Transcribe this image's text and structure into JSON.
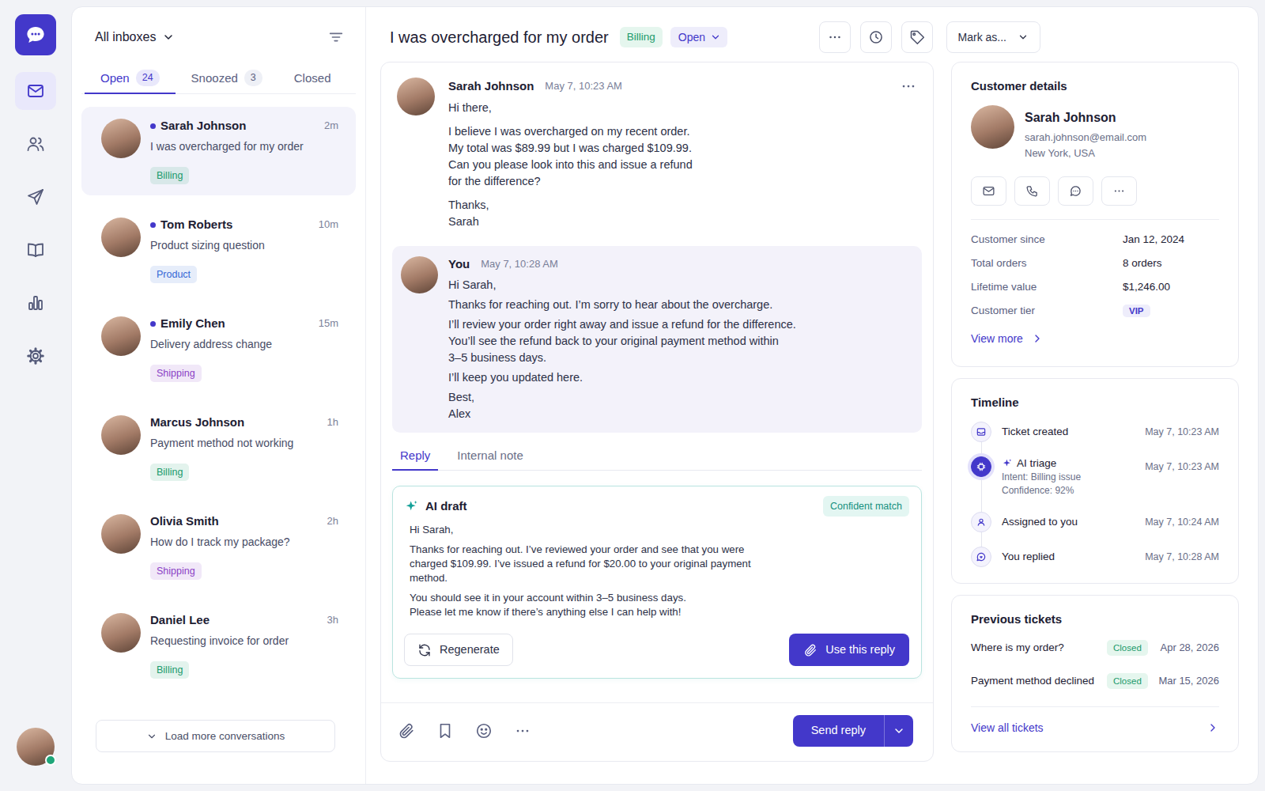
{
  "user": {
    "online": true
  },
  "rail": {
    "items": [
      {
        "selected": true
      },
      {
        "selected": false
      },
      {
        "selected": false
      },
      {
        "selected": false
      },
      {
        "selected": false
      },
      {
        "selected": false
      }
    ]
  },
  "inbox": {
    "label": "All inboxes"
  },
  "list_tabs": [
    {
      "label": "Open",
      "count": "24",
      "selected": true
    },
    {
      "label": "Snoozed",
      "count": "3",
      "selected": false
    },
    {
      "label": "Closed",
      "selected": false
    }
  ],
  "conversations": [
    {
      "name": "Sarah Johnson",
      "time": "2m",
      "subject": "I was overcharged for my order",
      "tag": {
        "label": "Billing",
        "color": "#1a9a6b"
      },
      "unread": true,
      "selected": true
    },
    {
      "name": "Tom Roberts",
      "time": "10m",
      "subject": "Product sizing question",
      "tag": {
        "label": "Product",
        "color": "#3467d6"
      },
      "unread": true,
      "selected": false
    },
    {
      "name": "Emily Chen",
      "time": "15m",
      "subject": "Delivery address change",
      "tag": {
        "label": "Shipping",
        "color": "#8b3fc6"
      },
      "unread": true,
      "selected": false
    },
    {
      "name": "Marcus Johnson",
      "time": "1h",
      "subject": "Payment method not working",
      "tag": {
        "label": "Billing",
        "color": "#1a9a6b"
      },
      "unread": false,
      "selected": false
    },
    {
      "name": "Olivia Smith",
      "time": "2h",
      "subject": "How do I track my package?",
      "tag": {
        "label": "Shipping",
        "color": "#8b3fc6"
      },
      "unread": false,
      "selected": false
    },
    {
      "name": "Daniel Lee",
      "time": "3h",
      "subject": "Requesting invoice for order",
      "tag": {
        "label": "Billing",
        "color": "#1a9a6b"
      },
      "unread": false,
      "selected": false
    }
  ],
  "load_more": "Load more conversations",
  "ticket": {
    "title": "I was overcharged for my order",
    "category": "Billing",
    "status": "Open",
    "mark_as": "Mark as..."
  },
  "messages": [
    {
      "kind": "customer",
      "author": "Sarah Johnson",
      "time": "May 7, 10:23 AM",
      "paragraphs": [
        [
          "Hi there,"
        ],
        [
          "I believe I was overcharged on my recent order.",
          "My total was $89.99 but I was charged $109.99.",
          "Can you please look into this and issue a refund",
          "for the difference?"
        ],
        [
          "Thanks,",
          "Sarah"
        ]
      ]
    },
    {
      "kind": "agent",
      "author": "You",
      "time": "May 7, 10:28 AM",
      "paragraphs": [
        [
          "Hi Sarah,"
        ],
        [
          "Thanks for reaching out. I’m sorry to hear about the overcharge."
        ],
        [
          "I’ll review your order right away and issue a refund for the difference.",
          "You’ll see the refund back to your original payment method within",
          "3–5 business days."
        ],
        [
          "I’ll keep you updated here."
        ],
        [
          "Best,",
          "Alex"
        ]
      ]
    }
  ],
  "reply_tabs": [
    {
      "label": "Reply",
      "selected": true
    },
    {
      "label": "Internal note",
      "selected": false
    }
  ],
  "ai_draft": {
    "title": "AI draft",
    "badge": "Confident match",
    "paragraphs": [
      [
        "Hi Sarah,"
      ],
      [
        "Thanks for reaching out. I’ve reviewed your order and see that you were",
        "charged $109.99. I’ve issued a refund for $20.00 to your original payment",
        "method."
      ],
      [
        "You should see it in your account within 3–5 business days.",
        "Please let me know if there’s anything else I can help with!"
      ]
    ],
    "regenerate": "Regenerate",
    "use": "Use this reply"
  },
  "composer": {
    "send": "Send reply"
  },
  "customer": {
    "title": "Customer details",
    "name": "Sarah Johnson",
    "email": "sarah.johnson@email.com",
    "location": "New York, USA",
    "stats": [
      {
        "label": "Customer since",
        "value": "Jan 12, 2024",
        "kind": "text"
      },
      {
        "label": "Total orders",
        "value": "8 orders",
        "kind": "text"
      },
      {
        "label": "Lifetime value",
        "value": "$1,246.00",
        "kind": "text"
      },
      {
        "label": "Customer tier",
        "value": "VIP",
        "kind": "badge"
      }
    ],
    "view_more": "View more"
  },
  "timeline": {
    "title": "Timeline",
    "events": [
      {
        "label": "Ticket created",
        "time": "May 7, 10:23 AM",
        "details": [],
        "highlighted": false
      },
      {
        "label": "AI triage",
        "time": "May 7, 10:23 AM",
        "details": [
          "Intent: Billing issue",
          "Confidence: 92%"
        ],
        "highlighted": true
      },
      {
        "label": "Assigned to you",
        "time": "May 7, 10:24 AM",
        "details": [],
        "highlighted": false
      },
      {
        "label": "You replied",
        "time": "May 7, 10:28 AM",
        "details": [],
        "highlighted": false
      }
    ]
  },
  "previous_tickets": {
    "title": "Previous tickets",
    "items": [
      {
        "subject": "Where is my order?",
        "status": "Closed",
        "date": "Apr 28, 2026"
      },
      {
        "subject": "Payment method declined",
        "status": "Closed",
        "date": "Mar 15, 2026"
      }
    ],
    "view_all": "View all tickets"
  }
}
